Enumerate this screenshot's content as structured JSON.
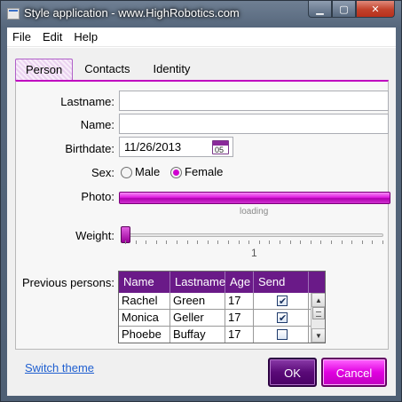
{
  "window": {
    "title": "Style application - www.HighRobotics.com"
  },
  "menu": [
    "File",
    "Edit",
    "Help"
  ],
  "tabs": [
    "Person",
    "Contacts",
    "Identity"
  ],
  "form": {
    "lastname_label": "Lastname:",
    "name_label": "Name:",
    "birthdate_label": "Birthdate:",
    "birthdate_value": "11/26/2013",
    "calendar_day": "05",
    "sex_label": "Sex:",
    "sex_options": [
      "Male",
      "Female"
    ],
    "sex_selected": "Female",
    "photo_label": "Photo:",
    "photo_status": "loading",
    "weight_label": "Weight:",
    "weight_value": "1",
    "previous_label": "Previous persons:"
  },
  "grid": {
    "columns": [
      "Name",
      "Lastname",
      "Age",
      "Send sms"
    ],
    "rows": [
      {
        "name": "Rachel",
        "lastname": "Green",
        "age": "17",
        "send_sms": true
      },
      {
        "name": "Monica",
        "lastname": "Geller",
        "age": "17",
        "send_sms": true
      },
      {
        "name": "Phoebe",
        "lastname": "Buffay",
        "age": "17",
        "send_sms": false
      }
    ]
  },
  "footer": {
    "switch_theme": "Switch theme",
    "ok": "OK",
    "cancel": "Cancel"
  },
  "colors": {
    "accent": "#d000d0",
    "header": "#6a1a88"
  }
}
